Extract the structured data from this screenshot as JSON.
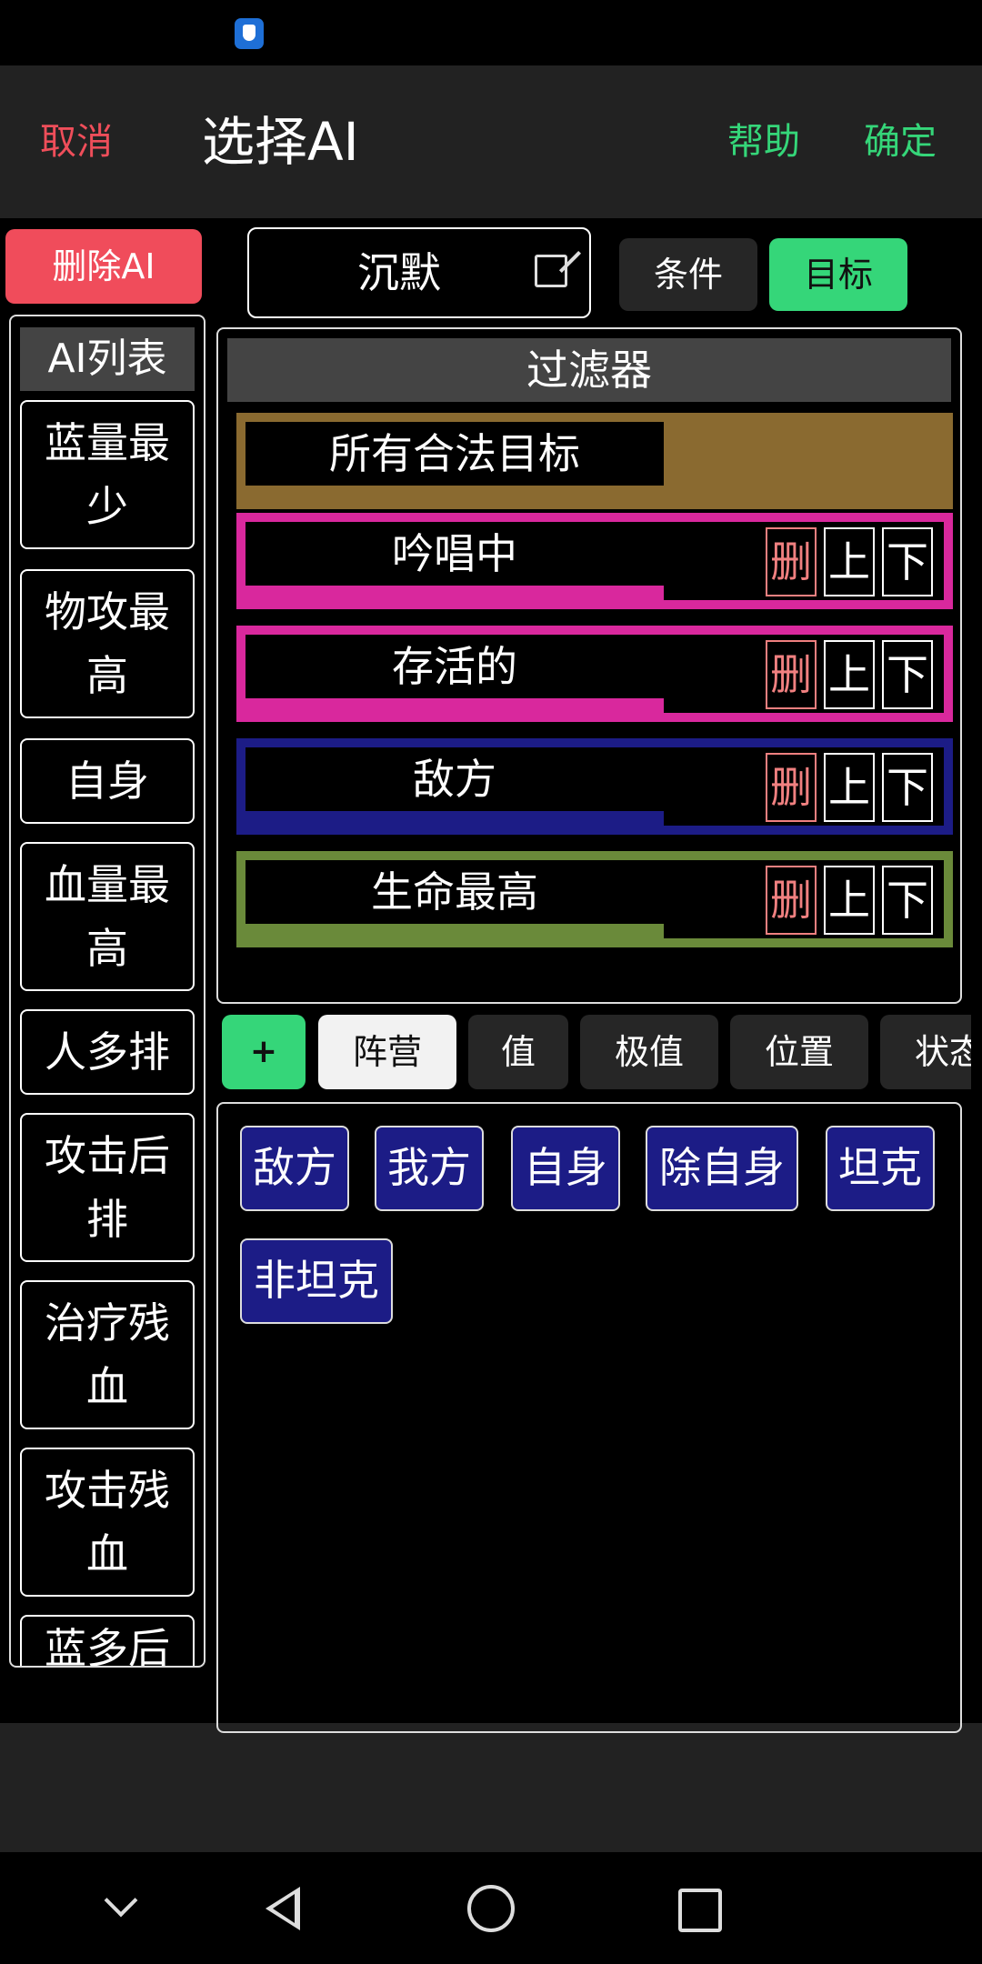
{
  "header": {
    "cancel": "取消",
    "title": "选择AI",
    "help": "帮助",
    "confirm": "确定"
  },
  "toolbar": {
    "delete_ai": "删除AI",
    "ai_name": "沉默",
    "tab_condition": "条件",
    "tab_target": "目标"
  },
  "sidebar": {
    "title": "AI列表",
    "items": [
      {
        "label": "蓝量最少"
      },
      {
        "label": "物攻最高"
      },
      {
        "label": "自身"
      },
      {
        "label": "血量最高"
      },
      {
        "label": "人多排"
      },
      {
        "label": "攻击后排"
      },
      {
        "label": "治疗残血"
      },
      {
        "label": "攻击残血"
      },
      {
        "label": "蓝多后"
      }
    ]
  },
  "filter": {
    "title": "过滤器",
    "rows": [
      {
        "label": "所有合法目标",
        "color": "#8a6a30",
        "has_actions": false
      },
      {
        "label": "吟唱中",
        "color": "#d9289d",
        "has_actions": true
      },
      {
        "label": "存活的",
        "color": "#d9289d",
        "has_actions": true
      },
      {
        "label": "敌方",
        "color": "#1c1c86",
        "has_actions": true
      },
      {
        "label": "生命最高",
        "color": "#6a8a3a",
        "has_actions": true
      }
    ],
    "btn_delete": "删",
    "btn_up": "上",
    "btn_down": "下"
  },
  "categories": {
    "add": "+",
    "items": [
      "阵营",
      "值",
      "极值",
      "位置",
      "状态"
    ],
    "active": "阵营"
  },
  "options": [
    "敌方",
    "我方",
    "自身",
    "除自身",
    "坦克",
    "非坦克"
  ],
  "colors": {
    "accent_green": "#35d679",
    "accent_red": "#f04c5b",
    "chip_blue": "#1c1c86"
  }
}
